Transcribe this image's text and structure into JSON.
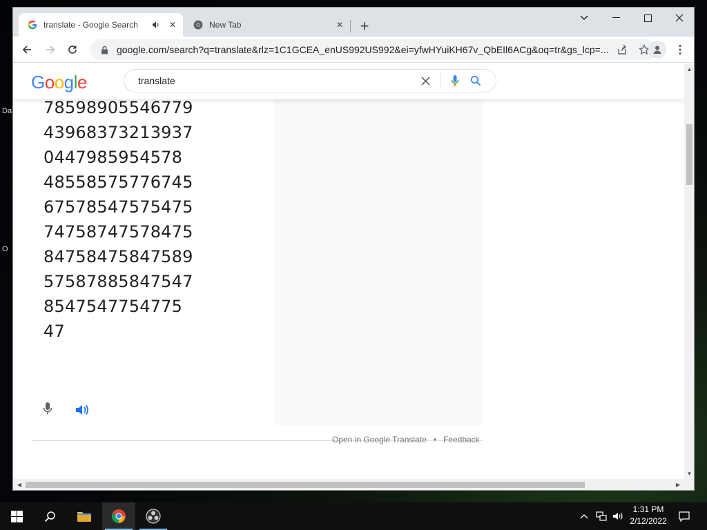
{
  "desktop": {
    "edge_labels": [
      "Da",
      "O"
    ]
  },
  "browser": {
    "tabs": [
      {
        "title": "translate - Google Search",
        "active": true
      },
      {
        "title": "New Tab",
        "active": false
      }
    ],
    "address_bar": {
      "url": "google.com/search?q=translate&rlz=1C1GCEA_enUS992US992&ei=yfwHYuiKH67v_QbEIl6ACg&oq=tr&gs_lcp=..."
    }
  },
  "google": {
    "logo_text": "Google",
    "logo_colors": [
      "#4285F4",
      "#EA4335",
      "#FBBC05",
      "#4285F4",
      "#34A853",
      "#EA4335"
    ],
    "search_query": "translate"
  },
  "translate_widget": {
    "output_lines": [
      "78598905546779",
      "43968373213937",
      "0447985954578",
      "48558575776745",
      "67578547575475",
      "74758747578475",
      "84758475847589",
      "57587885847547",
      "8547547754775",
      "47"
    ],
    "open_link": "Open in Google Translate",
    "separator": "•",
    "feedback_link": "Feedback"
  },
  "taskbar": {
    "time": "1:31 PM",
    "date": "2/12/2022"
  },
  "colors": {
    "accent_blue": "#1a73e8",
    "taskbar_bg": "#0f0f0f"
  }
}
